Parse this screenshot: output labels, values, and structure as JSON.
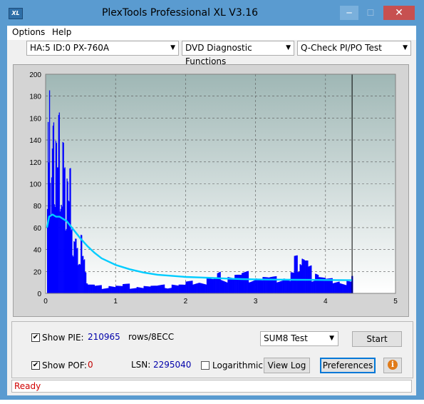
{
  "window": {
    "title": "PlexTools Professional XL V3.16",
    "icon_text": "XL",
    "minimize_glyph": "─",
    "maximize_glyph": "☐",
    "close_glyph": "✕"
  },
  "menu": {
    "items": [
      {
        "label": "Options"
      },
      {
        "label": "Help"
      }
    ]
  },
  "toolbar": {
    "drive": "HA:5 ID:0  PX-760A",
    "function": "DVD Diagnostic Functions",
    "test": "Q-Check PI/PO Test"
  },
  "chart_data": {
    "type": "bar",
    "xlim": [
      0,
      5
    ],
    "ylim": [
      0,
      200
    ],
    "x_ticks": [
      "0",
      "1",
      "2",
      "3",
      "4",
      "5"
    ],
    "y_ticks": [
      "0",
      "20",
      "40",
      "60",
      "80",
      "100",
      "120",
      "140",
      "160",
      "180",
      "200"
    ],
    "grid": true,
    "end_marker_x": 4.38,
    "series": [
      {
        "kind": "bars",
        "color": "#0000ff",
        "x": [
          0.02,
          0.03,
          0.04,
          0.05,
          0.06,
          0.07,
          0.08,
          0.09,
          0.1,
          0.12,
          0.14,
          0.16,
          0.18,
          0.2,
          0.22,
          0.24,
          0.26,
          0.28,
          0.3,
          0.32,
          0.34,
          0.36,
          0.38,
          0.4,
          0.42,
          0.44,
          0.46,
          0.48,
          0.5,
          0.52,
          0.54,
          0.56,
          0.58,
          0.6,
          0.7,
          0.8,
          0.9,
          1.0,
          1.1,
          1.2,
          1.3,
          1.4,
          1.5,
          1.6,
          1.7,
          1.8,
          1.9,
          2.0,
          2.1,
          2.2,
          2.3,
          2.4,
          2.45,
          2.5,
          2.6,
          2.7,
          2.8,
          2.9,
          3.0,
          3.1,
          3.2,
          3.3,
          3.4,
          3.5,
          3.55,
          3.6,
          3.63,
          3.66,
          3.7,
          3.75,
          3.8,
          3.85,
          3.9,
          4.0,
          4.1,
          4.2,
          4.3,
          4.37
        ],
        "values": [
          140,
          185,
          120,
          200,
          150,
          95,
          110,
          135,
          195,
          130,
          155,
          115,
          185,
          125,
          100,
          140,
          120,
          80,
          150,
          90,
          115,
          70,
          60,
          55,
          50,
          45,
          40,
          35,
          55,
          35,
          40,
          30,
          10,
          8,
          8,
          7,
          8,
          7,
          9,
          6,
          8,
          7,
          7,
          9,
          8,
          9,
          8,
          12,
          13,
          12,
          14,
          15,
          25,
          18,
          16,
          17,
          22,
          18,
          16,
          15,
          16,
          15,
          18,
          20,
          35,
          25,
          42,
          35,
          30,
          28,
          18,
          22,
          15,
          14,
          13,
          13,
          12,
          16
        ]
      },
      {
        "kind": "line",
        "color": "#00ccff",
        "x": [
          0.02,
          0.05,
          0.1,
          0.15,
          0.2,
          0.3,
          0.4,
          0.5,
          0.6,
          0.7,
          0.8,
          1.0,
          1.2,
          1.4,
          1.6,
          1.8,
          2.0,
          2.2,
          2.4,
          2.6,
          2.8,
          3.0,
          3.2,
          3.4,
          3.6,
          3.8,
          4.0,
          4.2,
          4.38
        ],
        "values": [
          60,
          70,
          72,
          70,
          70,
          66,
          58,
          50,
          43,
          37,
          32,
          26,
          22,
          19,
          17,
          16,
          15,
          14.5,
          14,
          13.5,
          13,
          12.8,
          12.6,
          12.5,
          12.4,
          12.3,
          12.2,
          12.1,
          12
        ]
      }
    ]
  },
  "controls": {
    "show_pie_label": "Show PIE:",
    "show_pie_checked": true,
    "pie_value": "210965",
    "pie_unit": "rows/8ECC",
    "show_poe_label": "Show POF:",
    "show_poe_checked": true,
    "poe_value": "0",
    "lsn_label": "LSN:",
    "lsn_value": "2295040",
    "logarithmic_label": "Logarithmic",
    "logarithmic_checked": false,
    "test_select": "SUM8 Test",
    "start_label": "Start",
    "viewlog_label": "View Log",
    "preferences_label": "Preferences",
    "info_glyph": "i",
    "check_glyph": "✔",
    "combo_arrow": "▼"
  },
  "status": {
    "text": "Ready"
  }
}
